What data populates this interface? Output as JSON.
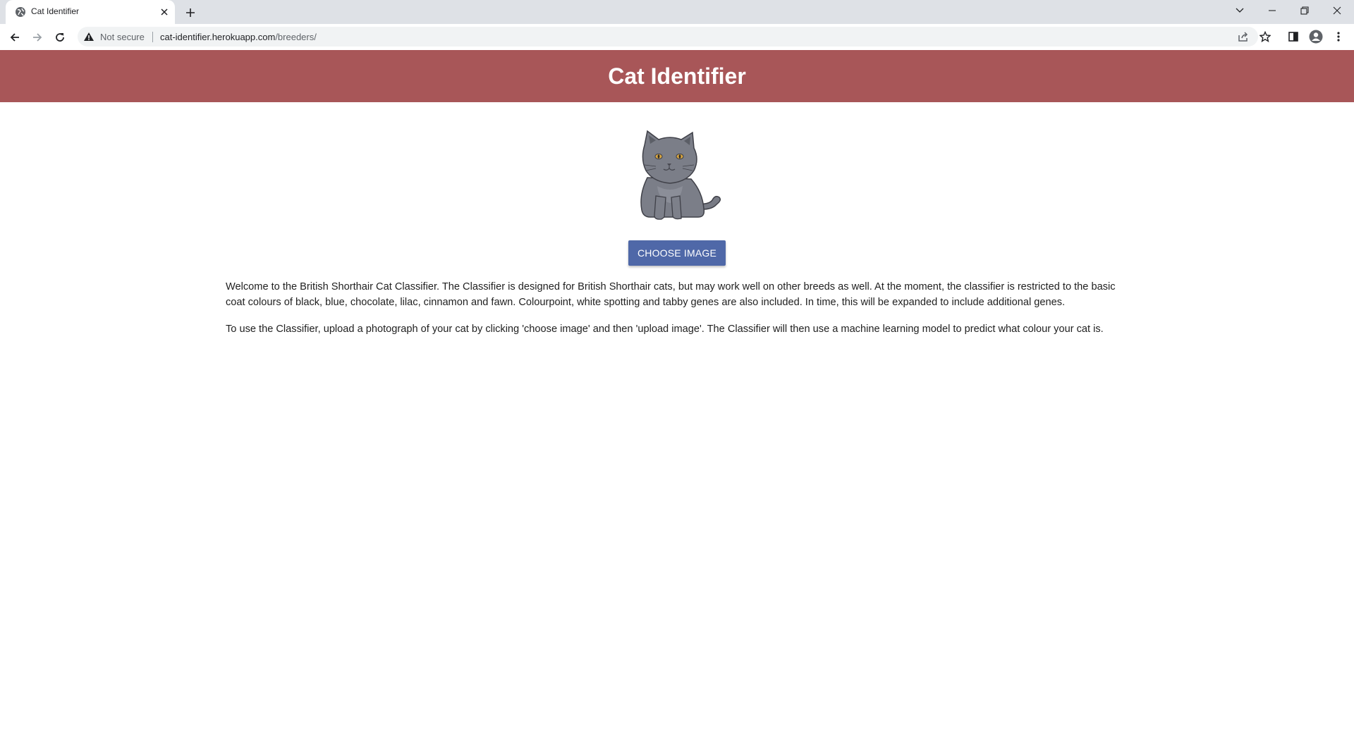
{
  "browser": {
    "tab_title": "Cat Identifier",
    "security_label": "Not secure",
    "url_host": "cat-identifier.herokuapp.com",
    "url_path": "/breeders/",
    "icons": [
      "globe-icon",
      "close-icon",
      "plus-icon",
      "chevron-down-icon",
      "minimize-icon",
      "restore-icon",
      "close-window-icon",
      "back-icon",
      "forward-icon",
      "reload-icon",
      "warning-icon",
      "share-icon",
      "star-icon",
      "side-panel-icon",
      "profile-icon",
      "more-icon"
    ]
  },
  "page": {
    "header_title": "Cat Identifier",
    "header_color": "#a85658",
    "button_color": "#4f68a8",
    "choose_button_label": "CHOOSE IMAGE",
    "paragraphs": [
      "Welcome to the British Shorthair Cat Classifier. The Classifier is designed for British Shorthair cats, but may work well on other breeds as well. At the moment, the classifier is restricted to the basic coat colours of black, blue, chocolate, lilac, cinnamon and fawn. Colourpoint, white spotting and tabby genes are also included. In time, this will be expanded to include additional genes.",
      "To use the Classifier, upload a photograph of your cat by clicking 'choose image' and then 'upload image'. The Classifier will then use a machine learning model to predict what colour your cat is."
    ]
  }
}
